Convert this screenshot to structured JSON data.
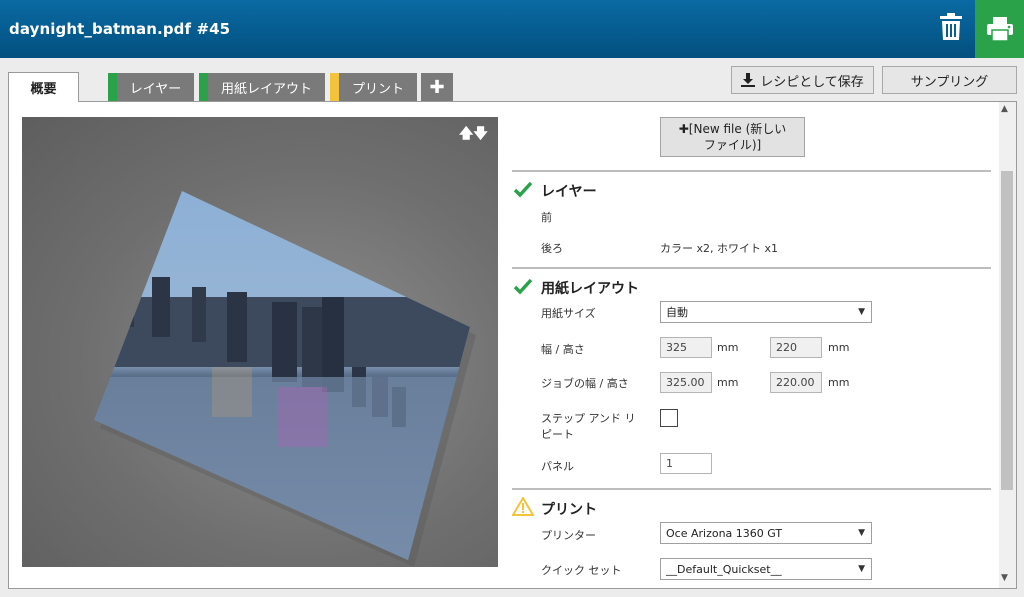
{
  "header": {
    "title": "daynight_batman.pdf #45",
    "accent": "#02507f",
    "print_color": "#2aa24a"
  },
  "tabs": [
    {
      "label": "概要"
    },
    {
      "label": "レイヤー",
      "marker": "#2aa24a"
    },
    {
      "label": "用紙レイアウト",
      "marker": "#2aa24a"
    },
    {
      "label": "プリント",
      "marker": "#f2c33b"
    },
    {
      "label": "✚"
    }
  ],
  "toolbar": {
    "save_recipe": "レシピとして保存",
    "sampling": "サンプリング"
  },
  "new_file": {
    "line1": "✚[New file (新しい",
    "line2": "ファイル)]"
  },
  "layer": {
    "title": "レイヤー",
    "front_label": "前",
    "back_label": "後ろ",
    "back_value": "カラー x2, ホワイト x1"
  },
  "layout": {
    "title": "用紙レイアウト",
    "paper_size_label": "用紙サイズ",
    "paper_size_value": "自動",
    "wh_label": "幅 / 高さ",
    "width": "325",
    "height": "220",
    "job_wh_label": "ジョブの幅 / 高さ",
    "job_width": "325.00",
    "job_height": "220.00",
    "unit": "mm",
    "step_repeat_line1": "ステップ アンド リ",
    "step_repeat_line2": "ピート",
    "panel_label": "パネル",
    "panel_value": "1"
  },
  "print": {
    "title": "プリント",
    "printer_label": "プリンター",
    "printer_value": "Oce Arizona 1360 GT",
    "quickset_label": "クイック セット",
    "quickset_value": "__Default_Quickset__"
  }
}
